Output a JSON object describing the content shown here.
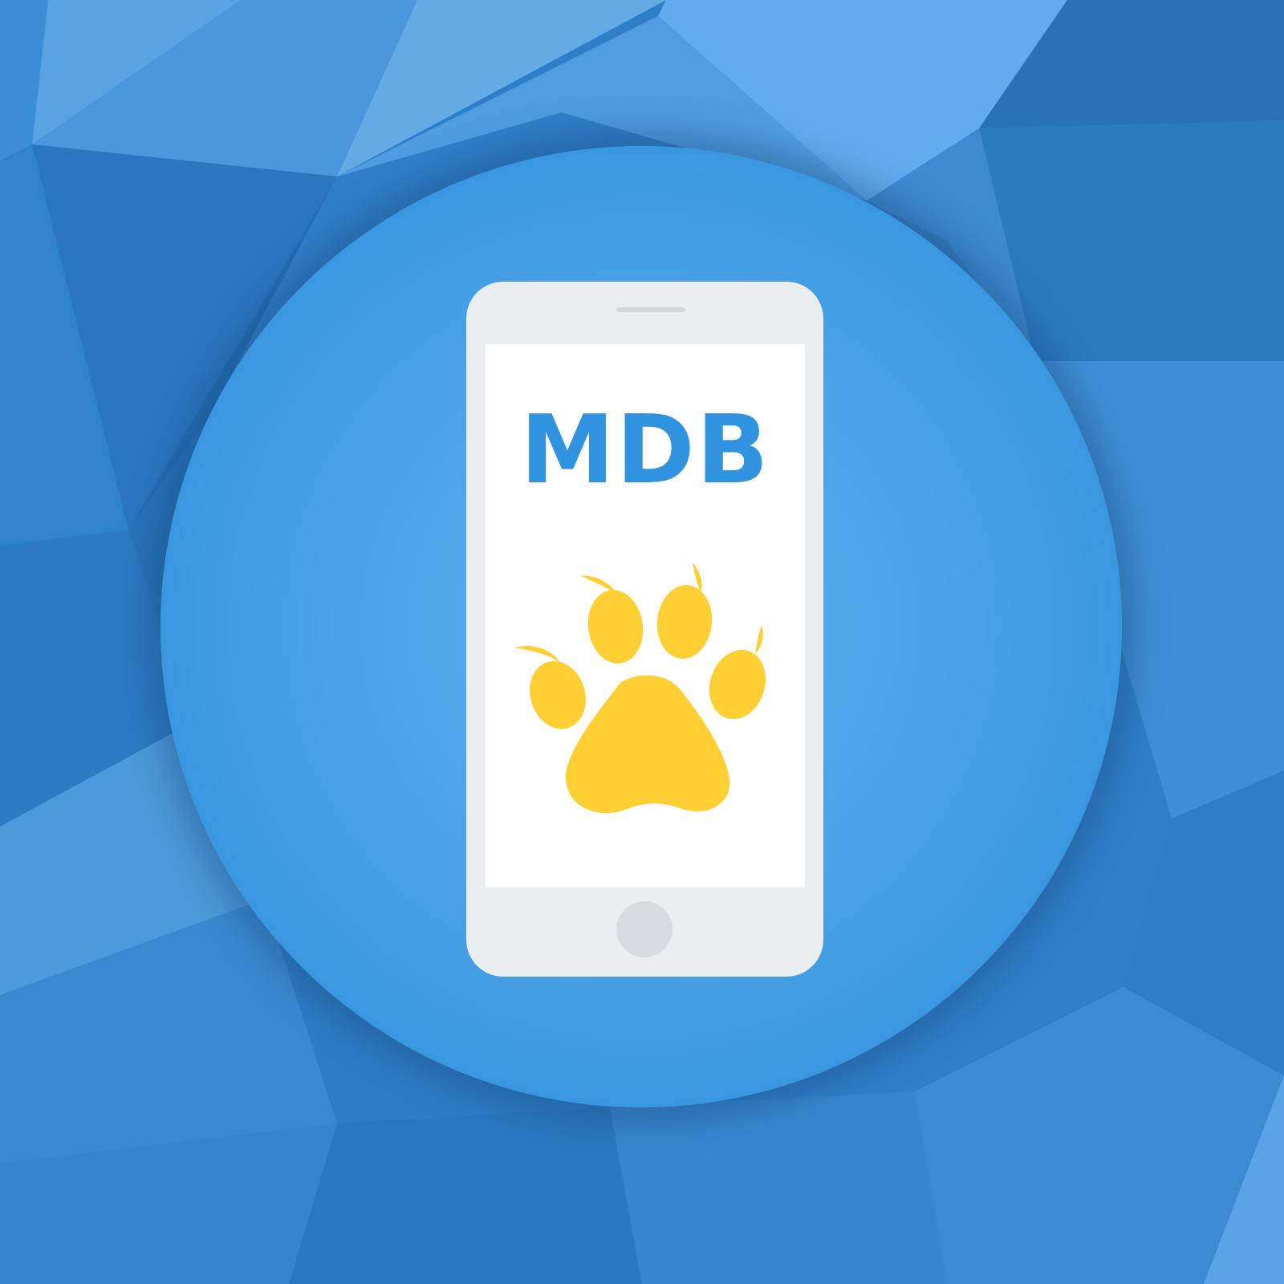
{
  "brand": {
    "text": "MDB",
    "color": "#2f93e0"
  },
  "paw": {
    "icon": "paw-icon",
    "color": "#ffcf33"
  },
  "colors": {
    "background": "#2f7fc8",
    "circle": "#4ba3e8",
    "phone_body": "#ebeeef",
    "screen": "#ffffff"
  }
}
